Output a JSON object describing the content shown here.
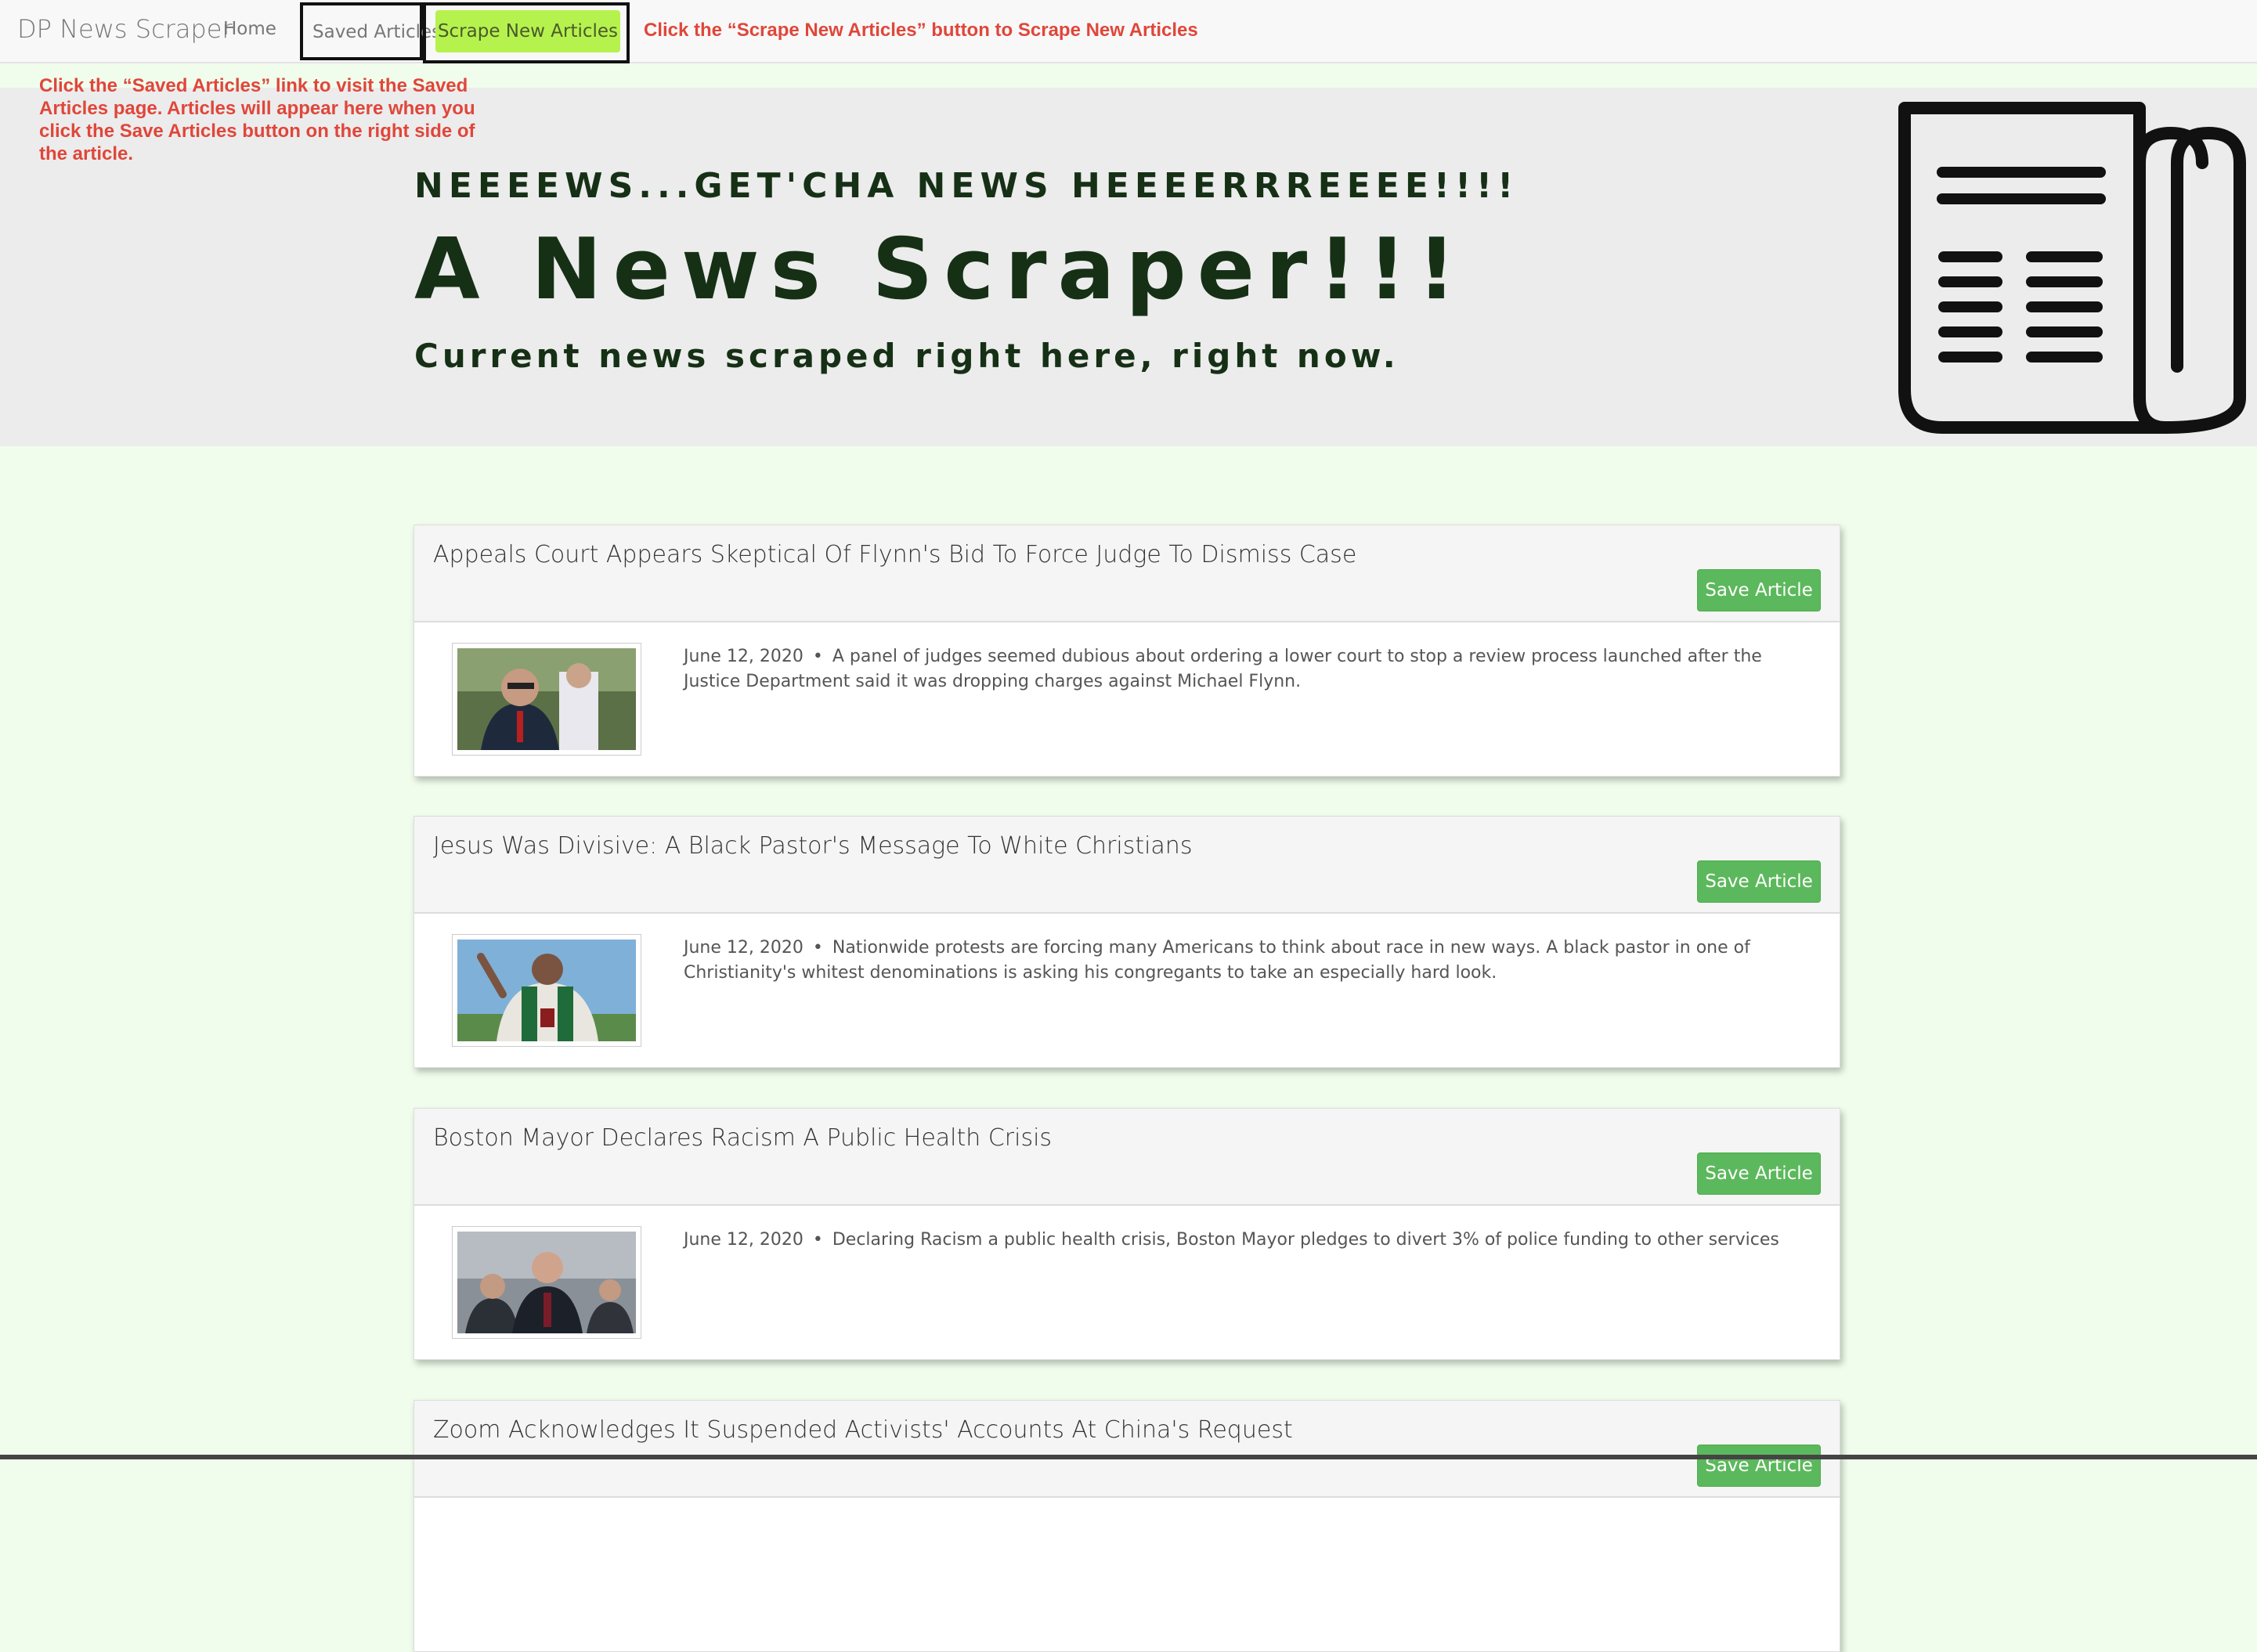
{
  "navbar": {
    "brand": "DP News Scraper",
    "home": "Home",
    "saved_articles": "Saved Articles",
    "scrape_button": "Scrape New Articles"
  },
  "annotations": {
    "top": "Click the “Scrape New Articles” button to Scrape New Articles",
    "left": "Click the “Saved Articles” link to visit the Saved Articles page. Articles will appear here when you click the Save Articles button on the right side of the article."
  },
  "jumbotron": {
    "kicker": "NEEEEWS...GET'CHA NEWS HEEEERRREEEE!!!!",
    "headline": "A News Scraper!!!",
    "lead": "Current news scraped right here, right now.",
    "icon": "newspaper-icon"
  },
  "articles": [
    {
      "title": "Appeals Court Appears Skeptical Of Flynn's Bid To Force Judge To Dismiss Case",
      "save_label": "Save Article",
      "date": "June 12, 2020",
      "summary": "A panel of judges seemed dubious about ordering a lower court to stop a review process launched after the Justice Department said it was dropping charges against Michael Flynn."
    },
    {
      "title": "Jesus Was Divisive: A Black Pastor's Message To White Christians",
      "save_label": "Save Article",
      "date": "June 12, 2020",
      "summary": "Nationwide protests are forcing many Americans to think about race in new ways. A black pastor in one of Christianity's whitest denominations is asking his congregants to take an especially hard look."
    },
    {
      "title": "Boston Mayor Declares Racism A Public Health Crisis",
      "save_label": "Save Article",
      "date": "June 12, 2020",
      "summary": "Declaring Racism a public health crisis, Boston Mayor pledges to divert 3% of police funding to other services"
    },
    {
      "title": "Zoom Acknowledges It Suspended Activists' Accounts At China's Request",
      "save_label": "Save Article"
    }
  ],
  "colors": {
    "accent_green": "#5cb85c",
    "scrape_green": "#b6f24e",
    "annotation_red": "#e0463a",
    "page_bg": "#f0fdec"
  }
}
